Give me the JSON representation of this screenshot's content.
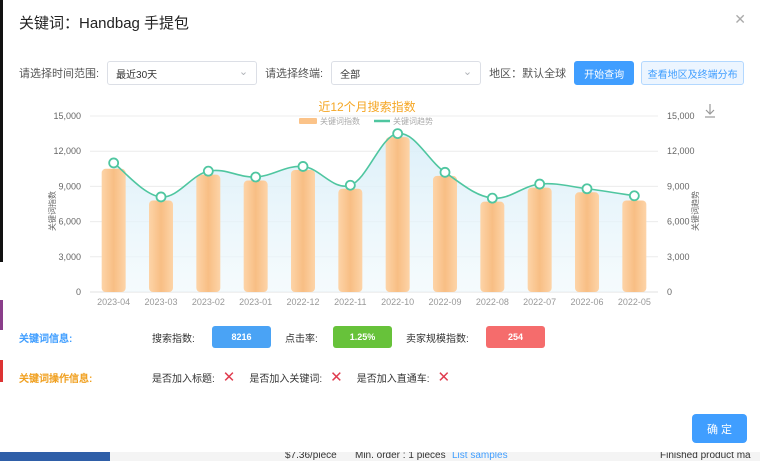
{
  "dialog": {
    "title": "关键词：Handbag 手提包",
    "close_icon": "close-icon"
  },
  "filters": {
    "time_label": "请选择时间范围:",
    "time_value": "最近30天",
    "terminal_label": "请选择终端:",
    "terminal_value": "全部",
    "region_label": "地区：默认全球",
    "query_button": "开始查询",
    "distribution_button": "查看地区及终端分布"
  },
  "chart_data": {
    "type": "bar",
    "title": "近12个月搜索指数",
    "categories": [
      "2023-04",
      "2023-03",
      "2023-02",
      "2023-01",
      "2022-12",
      "2022-11",
      "2022-10",
      "2022-09",
      "2022-08",
      "2022-07",
      "2022-06",
      "2022-05"
    ],
    "series": [
      {
        "name": "关键词指数",
        "type": "bar",
        "values": [
          10500,
          7800,
          10000,
          9500,
          10400,
          8800,
          13200,
          9900,
          7700,
          8900,
          8500,
          7800
        ],
        "color": "#fbc389"
      },
      {
        "name": "关键词趋势",
        "type": "line",
        "values": [
          11000,
          8100,
          10300,
          9800,
          10700,
          9100,
          13500,
          10200,
          8000,
          9200,
          8800,
          8200
        ],
        "color": "#4fc6a0"
      }
    ],
    "ylabel": "关键词指数",
    "ylabel_right": "关键词趋势",
    "ylim": [
      0,
      15000
    ],
    "y_ticks": [
      "0",
      "3,000",
      "6,000",
      "9,000",
      "12,000",
      "15,000"
    ],
    "grid": true,
    "legend": "top-center",
    "title_color": "#f5a623",
    "download_icon": "download-icon"
  },
  "info": {
    "label": "关键词信息:",
    "search_index_label": "搜索指数:",
    "search_index_value": "8216",
    "ctr_label": "点击率:",
    "ctr_value": "1.25%",
    "seller_label": "卖家规模指数:",
    "seller_value": "254",
    "colors": {
      "search": "#4aa3f5",
      "ctr": "#67c23a",
      "seller": "#f56c6c"
    }
  },
  "ops": {
    "label": "关键词操作信息:",
    "title_label": "是否加入标题:",
    "keyword_label": "是否加入关键词:",
    "ztc_label": "是否加入直通车:",
    "status_icon": "cross-icon"
  },
  "confirm_button": "确 定",
  "behind": {
    "price_text": "$7.36/piece",
    "moq_text": "Min. order : 1 pieces",
    "link_text": "List samples",
    "right_text": "Finished product ma"
  }
}
